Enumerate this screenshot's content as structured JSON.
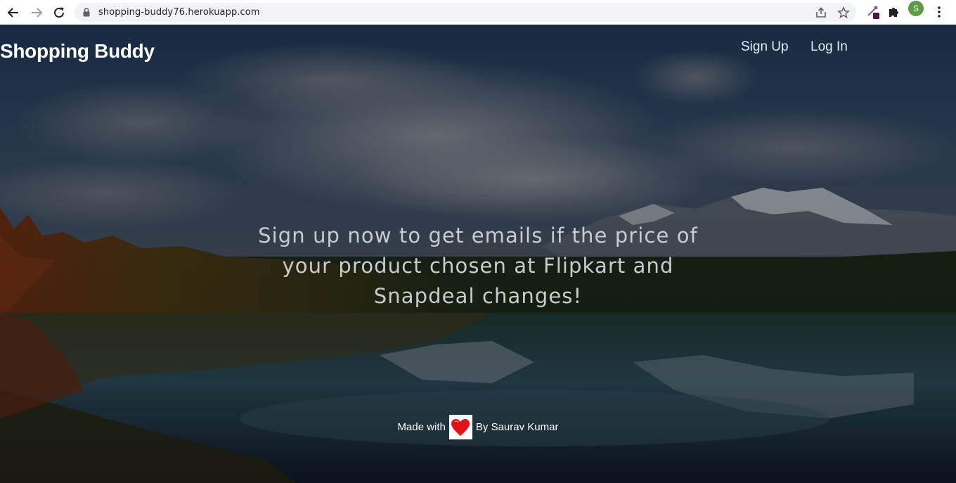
{
  "browser": {
    "url": "shopping-buddy76.herokuapp.com",
    "profile_initial": "S",
    "icons": [
      "back-arrow-icon",
      "forward-arrow-icon",
      "reload-icon",
      "lock-icon",
      "share-icon",
      "star-icon",
      "extension-icon",
      "puzzle-icon",
      "kebab-menu-icon"
    ]
  },
  "header": {
    "brand": "Shopping Buddy",
    "nav": {
      "signup": "Sign Up",
      "login": "Log In"
    }
  },
  "hero": {
    "tagline": "Sign up now to get emails if the price of your product chosen at Flipkart and Snapdeal changes!"
  },
  "footer": {
    "made_with": "Made with",
    "by": "By Saurav Kumar"
  },
  "colors": {
    "brand_text": "#ffffff",
    "tagline_text": "#c9cbd0",
    "profile_green": "#5c9c45"
  }
}
